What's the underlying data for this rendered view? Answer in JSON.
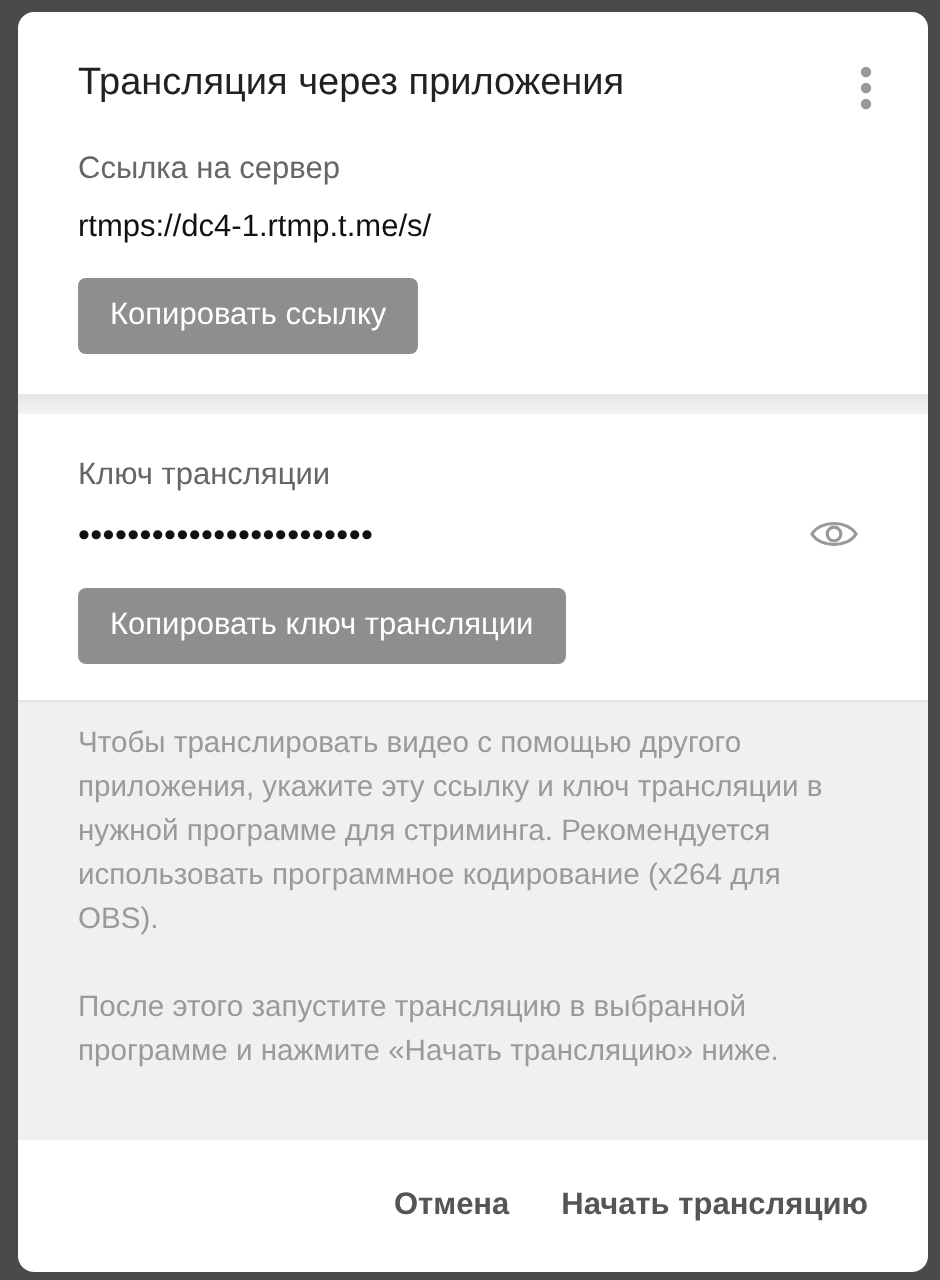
{
  "dialog": {
    "title": "Трансляция через приложения"
  },
  "server": {
    "label": "Ссылка на сервер",
    "value": "rtmps://dc4-1.rtmp.t.me/s/",
    "button": "Копировать ссылку"
  },
  "key": {
    "label": "Ключ трансляции",
    "value": "••••••••••••••••••••••••",
    "revealed": false,
    "button": "Копировать ключ трансляции"
  },
  "info": [
    "Чтобы транслировать видео с помощью другого приложения, укажите эту ссылку и ключ трансляции в нужной программе для стриминга. Рекомендуется использовать программное кодирование (x264 для OBS).",
    "После этого запустите трансляцию в выбранной программе и нажмите «Начать трансляцию» ниже."
  ],
  "buttons": [
    "Отмена",
    "Начать трансляцию"
  ]
}
